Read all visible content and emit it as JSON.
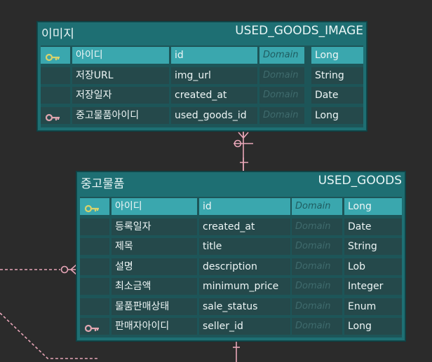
{
  "colors": {
    "background": "#2b2b2b",
    "entity_header": "#1e6f73",
    "entity_body": "#1d5558",
    "pk_row": "#3aa7ae",
    "key_icon": "#d8d36b",
    "fk_key_icon": "#e0a6b0",
    "relationship_line": "#e8a6b8"
  },
  "entities": {
    "image": {
      "logical": "이미지",
      "physical": "USED_GOODS_IMAGE",
      "rows": [
        {
          "logical": "아이디",
          "physical": "id",
          "domain": "Domain",
          "type": "Long",
          "key": "pk-key-icon"
        },
        {
          "logical": "저장URL",
          "physical": "img_url",
          "domain": "Domain",
          "type": "String",
          "key": ""
        },
        {
          "logical": "저장일자",
          "physical": "created_at",
          "domain": "Domain",
          "type": "Date",
          "key": ""
        },
        {
          "logical": "중고물품아이디",
          "physical": "used_goods_id",
          "domain": "Domain",
          "type": "Long",
          "key": "fk-key-icon"
        }
      ]
    },
    "goods": {
      "logical": "중고물품",
      "physical": "USED_GOODS",
      "rows": [
        {
          "logical": "아이디",
          "physical": "id",
          "domain": "Domain",
          "type": "Long",
          "key": "pk-key-icon"
        },
        {
          "logical": "등록일자",
          "physical": "created_at",
          "domain": "Domain",
          "type": "Date",
          "key": ""
        },
        {
          "logical": "제목",
          "physical": "title",
          "domain": "Domain",
          "type": "String",
          "key": ""
        },
        {
          "logical": "설명",
          "physical": "description",
          "domain": "Domain",
          "type": "Lob",
          "key": ""
        },
        {
          "logical": "최소금액",
          "physical": "minimum_price",
          "domain": "Domain",
          "type": "Integer",
          "key": ""
        },
        {
          "logical": "물품판매상태",
          "physical": "sale_status",
          "domain": "Domain",
          "type": "Enum",
          "key": ""
        },
        {
          "logical": "판매자아이디",
          "physical": "seller_id",
          "domain": "Domain",
          "type": "Long",
          "key": "fk-key-icon"
        }
      ]
    }
  }
}
